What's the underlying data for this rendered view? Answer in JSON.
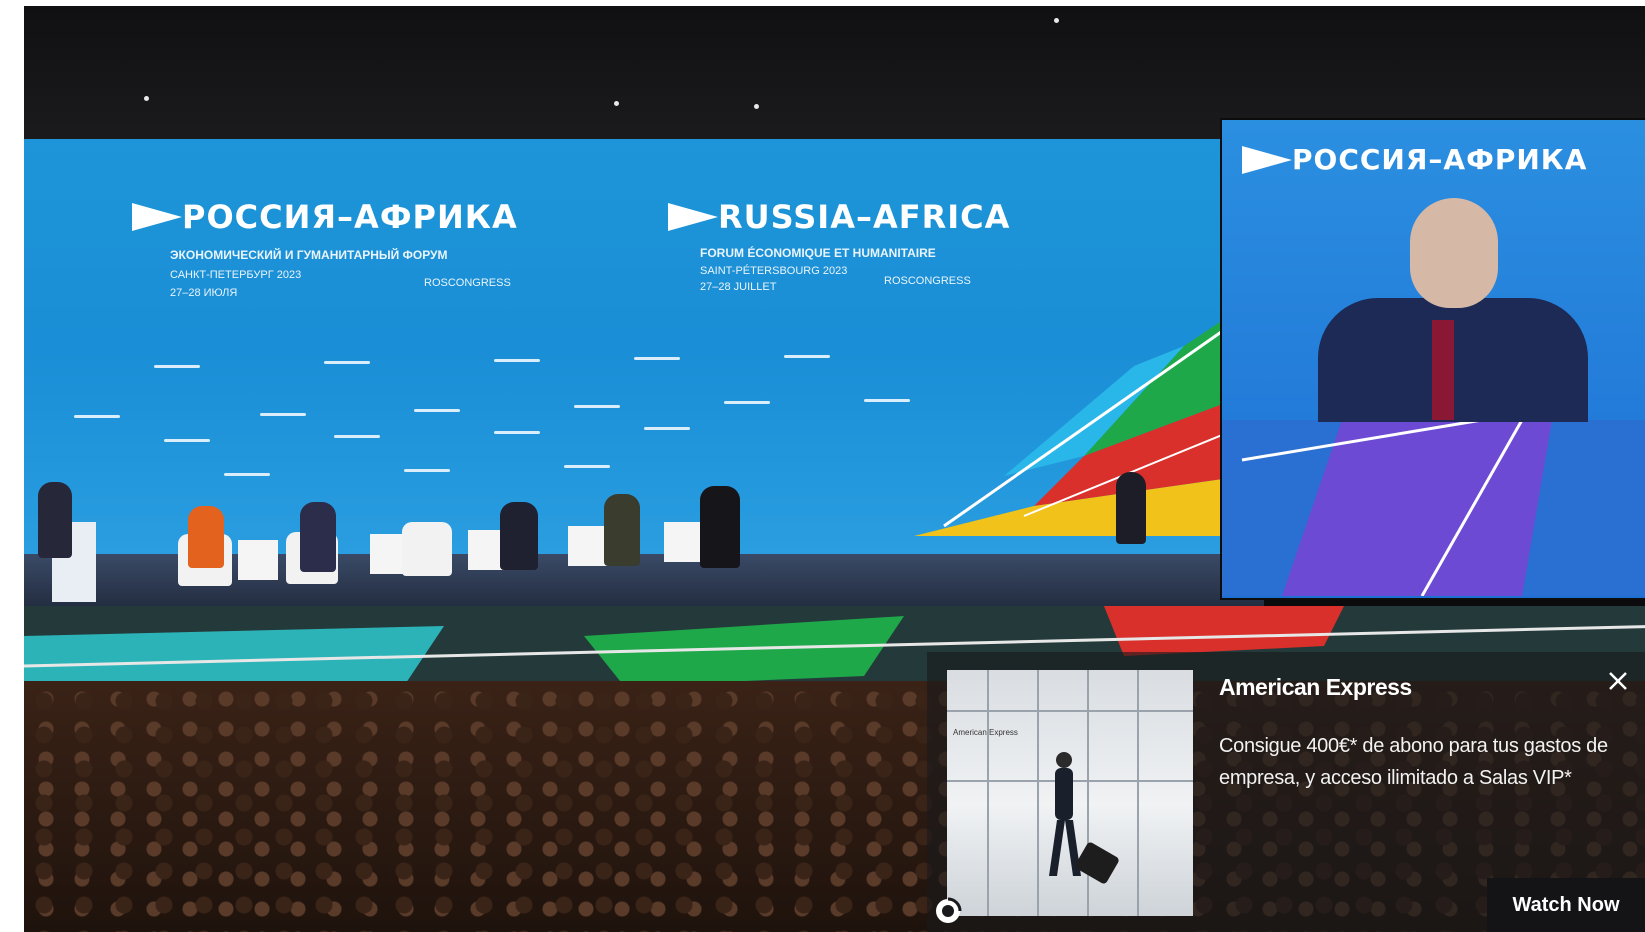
{
  "photo": {
    "backdrop_left_logo": "РОССИЯ–АФРИКА",
    "backdrop_left_sub_line1": "ЭКОНОМИЧЕСКИЙ И ГУМАНИТАРНЫЙ ФОРУМ",
    "backdrop_left_sub_line2": "САНКТ-ПЕТЕРБУРГ 2023",
    "backdrop_left_sub_line3": "27–28 ИЮЛЯ",
    "backdrop_left_org": "ROSCONGRESS",
    "backdrop_right_logo": "RUSSIA–AFRICA",
    "backdrop_right_sub_line1": "FORUM ÉCONOMIQUE ET HUMANITAIRE",
    "backdrop_right_sub_line2": "SAINT-PÉTERSBOURG 2023",
    "backdrop_right_sub_line3": "27–28 JUILLET",
    "backdrop_right_org": "ROSCONGRESS",
    "screen_logo": "РОССИЯ–АФРИКА"
  },
  "ad": {
    "brand": "American Express",
    "body": "Consigue 400€* de abono para tus gastos de empresa, y acceso ilimitado a Salas VIP*",
    "cta": "Watch Now",
    "close_icon": "close-icon",
    "choices_icon": "adchoices-icon",
    "thumb_caption": "American Express"
  },
  "colors": {
    "backdrop_blue": "#1a8ed6",
    "ad_overlay": "#1a1a1c",
    "text_white": "#ffffff"
  }
}
